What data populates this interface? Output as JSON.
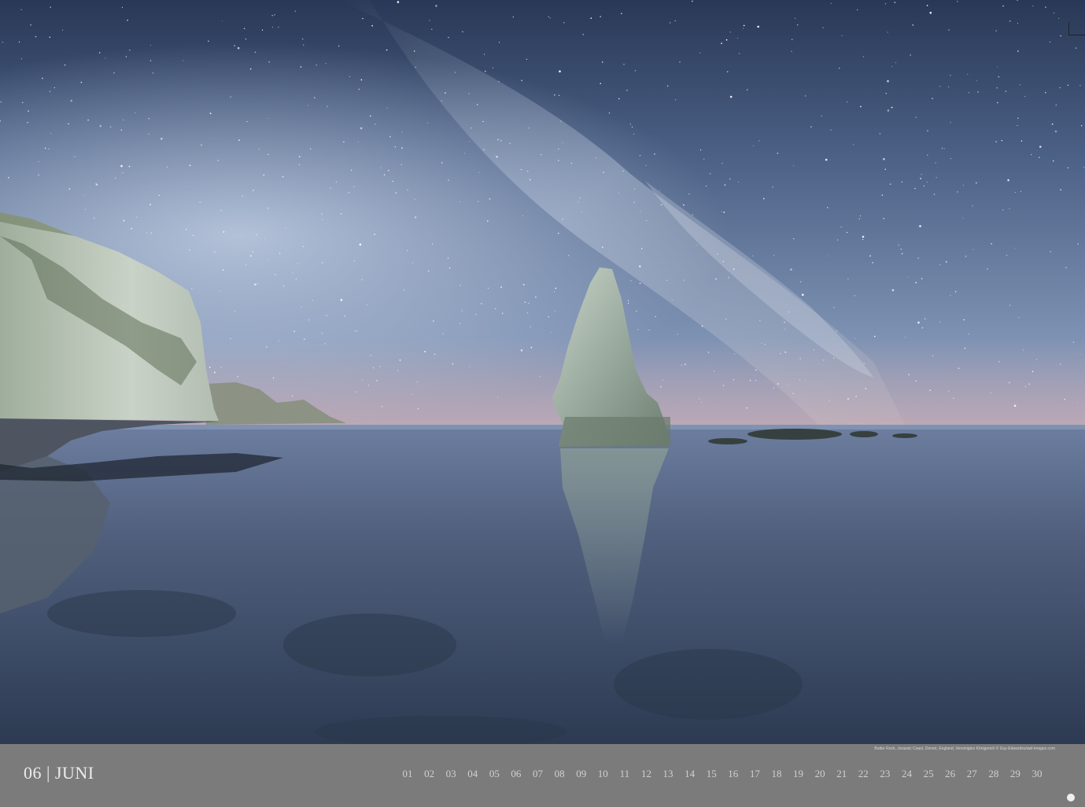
{
  "calendar": {
    "month_number": "06",
    "separator": "|",
    "month_name": "JUNI",
    "days": [
      "01",
      "02",
      "03",
      "04",
      "05",
      "06",
      "07",
      "08",
      "09",
      "10",
      "11",
      "12",
      "13",
      "14",
      "15",
      "16",
      "17",
      "18",
      "19",
      "20",
      "21",
      "22",
      "23",
      "24",
      "25",
      "26",
      "27",
      "28",
      "29",
      "30"
    ],
    "week_start_days": [
      "07",
      "14",
      "21",
      "28"
    ]
  },
  "caption": "Butter Rock, Jurassic Coast, Dorset, England, Vereinigtes Königreich © Guy Edwardes/awl-images.com",
  "photo": {
    "subject": "sea-stack-under-milky-way",
    "colors": {
      "sky_top": "#2c3b58",
      "horizon_glow": "#c8a3a8",
      "water": "#40506a",
      "cliff": "#b7c0b0"
    }
  }
}
